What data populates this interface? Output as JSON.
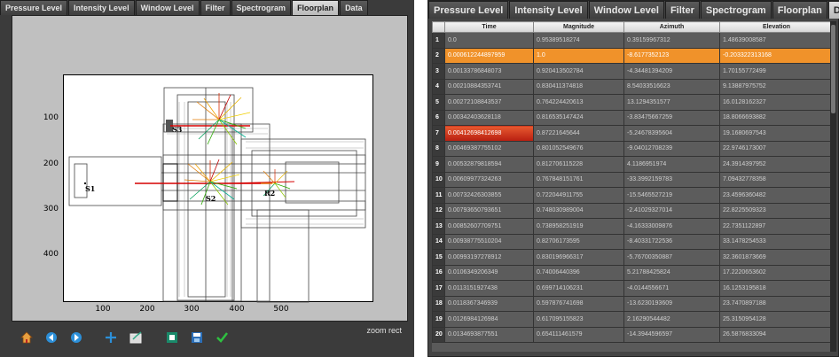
{
  "tabs": [
    "Pressure Level",
    "Intensity Level",
    "Window Level",
    "Filter",
    "Spectrogram",
    "Floorplan",
    "Data"
  ],
  "left": {
    "active_tab": "Floorplan",
    "status_text": "zoom rect",
    "y_ticks": [
      "100",
      "200",
      "300",
      "400"
    ],
    "x_ticks": [
      "100",
      "200",
      "300",
      "400",
      "500"
    ],
    "labels": {
      "s1": "S1",
      "s2": "S2",
      "s3": "S3",
      "r2": "R2"
    },
    "toolbar": [
      "home-icon",
      "back-arrow-icon",
      "forward-arrow-icon",
      "pan-icon",
      "zoom-rect-icon",
      "configure-subplots-icon",
      "save-icon",
      "check-icon"
    ]
  },
  "right": {
    "active_tab": "Data",
    "columns": [
      "Time",
      "Magnitude",
      "Azimuth",
      "Elevation"
    ],
    "rows": [
      [
        "1",
        "0.0",
        "0.95389518274",
        "0.39159967312",
        "1.48639008587"
      ],
      [
        "2",
        "0.000612244897959",
        "1.0",
        "-8.6177352123",
        "-0.203322313168"
      ],
      [
        "3",
        "0.00133786848073",
        "0.920413502784",
        "-4.34481394209",
        "1.70155772499"
      ],
      [
        "4",
        "0.00210884353741",
        "0.830411374818",
        "8.54033516623",
        "9.13887975752"
      ],
      [
        "5",
        "0.00272108843537",
        "0.764224420613",
        "13.1294351577",
        "16.0128162327"
      ],
      [
        "6",
        "0.00342403628118",
        "0.816535147424",
        "-3.83475667259",
        "18.8066693882"
      ],
      [
        "7",
        "0.00412698412698",
        "0.87221645644",
        "-5.24678395604",
        "19.1680697543"
      ],
      [
        "8",
        "0.00469387755102",
        "0.801052549676",
        "-9.04012708239",
        "22.9746173007"
      ],
      [
        "9",
        "0.00532879818594",
        "0.812706115228",
        "4.1186951974",
        "24.3914397952"
      ],
      [
        "10",
        "0.00609977324263",
        "0.767848151761",
        "-33.3992159783",
        "7.09432778358"
      ],
      [
        "11",
        "0.00732426303855",
        "0.722044911755",
        "-15.5465527219",
        "23.4596360482"
      ],
      [
        "12",
        "0.00793650793651",
        "0.748030989004",
        "-2.41029327014",
        "22.8225509323"
      ],
      [
        "13",
        "0.00852607709751",
        "0.738958251919",
        "-4.16333009876",
        "22.7351122897"
      ],
      [
        "14",
        "0.00938775510204",
        "0.82706173595",
        "-8.40331722536",
        "33.1478254533"
      ],
      [
        "15",
        "0.00993197278912",
        "0.830196966317",
        "-5.76700350887",
        "32.3601873669"
      ],
      [
        "16",
        "0.0106349206349",
        "0.74006440396",
        "5.21788425824",
        "17.2220653602"
      ],
      [
        "17",
        "0.0113151927438",
        "0.699714106231",
        "-4.0144556671",
        "16.1253195818"
      ],
      [
        "18",
        "0.0118367346939",
        "0.597876741698",
        "-13.6230193609",
        "23.7470897188"
      ],
      [
        "19",
        "0.0126984126984",
        "0.617095155823",
        "2.16290544482",
        "25.3150954128"
      ],
      [
        "20",
        "0.0134693877551",
        "0.654111461579",
        "-14.3944596597",
        "26.5876833094"
      ]
    ]
  },
  "colors": {
    "selected_row": "#f0922a",
    "hot_cell": "#c8301a",
    "accent": "#f0922a"
  }
}
